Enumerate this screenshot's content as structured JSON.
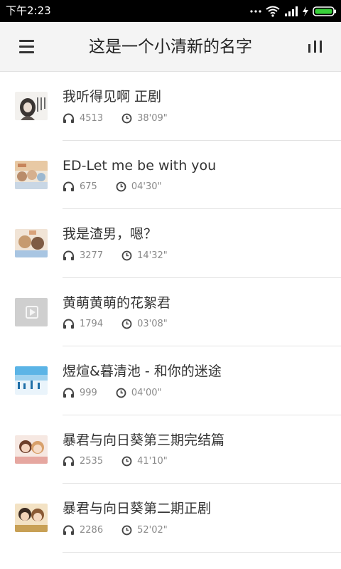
{
  "status_bar": {
    "time": "下午2:23",
    "icons": [
      "more-dots-icon",
      "wifi-icon",
      "signal-icon",
      "charging-icon",
      "battery-icon"
    ]
  },
  "app_bar": {
    "title": "这是一个小清新的名字",
    "left_icon": "menu-icon",
    "right_icon": "bar-chart-icon"
  },
  "colors": {
    "status_bg": "#000000",
    "app_bar_bg": "#f4f4f4",
    "title": "#222222",
    "item_title": "#333333",
    "meta": "#8a8a8a",
    "divider": "#e3e3e3"
  },
  "items": [
    {
      "title": "我听得见啊 正剧",
      "plays": "4513",
      "duration": "38'09\"",
      "thumb": "thumb-1"
    },
    {
      "title": "ED-Let me be with you",
      "plays": "675",
      "duration": "04'30\"",
      "thumb": "thumb-2"
    },
    {
      "title": "我是渣男，嗯？",
      "plays": "3277",
      "duration": "14'32\"",
      "thumb": "thumb-3"
    },
    {
      "title": "黄萌黄萌的花絮君",
      "plays": "1794",
      "duration": "03'08\"",
      "thumb": "thumb-4"
    },
    {
      "title": "煜煊&暮清池 - 和你的迷途",
      "plays": "999",
      "duration": "04'00\"",
      "thumb": "thumb-5"
    },
    {
      "title": "暴君与向日葵第三期完结篇",
      "plays": "2535",
      "duration": "41'10\"",
      "thumb": "thumb-6"
    },
    {
      "title": "暴君与向日葵第二期正剧",
      "plays": "2286",
      "duration": "52'02\"",
      "thumb": "thumb-7"
    }
  ]
}
